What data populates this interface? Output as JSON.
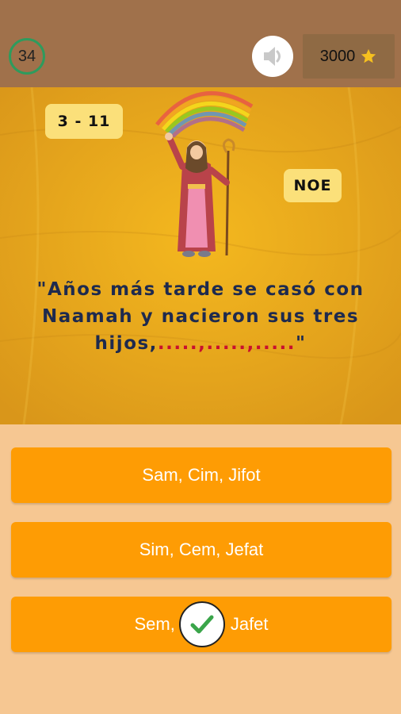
{
  "header": {
    "level_number": "34",
    "sound_icon": "speaker-icon",
    "coins": "3000",
    "coin_icon": "star-icon"
  },
  "question_panel": {
    "level_code": "3 - 11",
    "character_name": "NOE",
    "question_main": "\"Años más tarde se casó con Naamah y nacieron sus tres hijos,",
    "question_blank": ".....,.....,.....",
    "question_end": "\""
  },
  "answers": [
    {
      "label": "Sam, Cim, Jifot"
    },
    {
      "label": "Sim, Cem, Jefat"
    },
    {
      "label": "Sem,",
      "label_end": "Jafet",
      "correct": true
    }
  ],
  "colors": {
    "header_bg": "#a0714b",
    "panel_bg": "#e9a91a",
    "answer_bg": "#fe9c04",
    "page_bg": "#f6c792",
    "check_green": "#3aa54a"
  }
}
